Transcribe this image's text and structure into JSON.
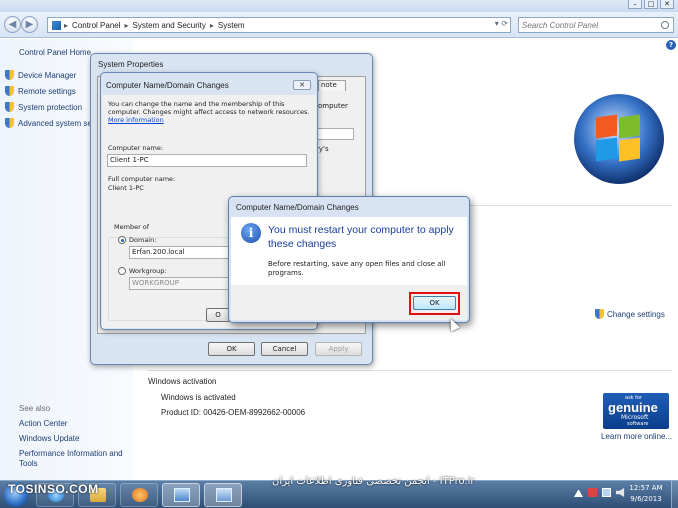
{
  "explorer": {
    "breadcrumbs": [
      "Control Panel",
      "System and Security",
      "System"
    ],
    "search_placeholder": "Search Control Panel"
  },
  "left_pane": {
    "home": "Control Panel Home",
    "links": [
      "Device Manager",
      "Remote settings",
      "System protection",
      "Advanced system se"
    ],
    "see_also_label": "See also",
    "see_also": [
      "Action Center",
      "Windows Update",
      "Performance Information and Tools"
    ]
  },
  "main": {
    "change_settings": "Change settings",
    "activation": {
      "title": "Windows activation",
      "status": "Windows is activated",
      "product_id": "Product ID: 00426-OEM-8992662-00006"
    },
    "genuine_badge": {
      "line1": "ask for",
      "line2": "genuine",
      "line3": "Microsoft",
      "line4": "software"
    },
    "learn_more": "Learn more online..."
  },
  "system_properties": {
    "title": "System Properties",
    "tab_fragment": "note",
    "text_fragments": [
      "omputer",
      "ry's"
    ],
    "buttons": {
      "ok": "OK",
      "cancel": "Cancel",
      "apply": "Apply"
    }
  },
  "name_domain_dialog": {
    "title": "Computer Name/Domain Changes",
    "close": "✕",
    "intro_line1": "You can change the name and the membership of this",
    "intro_line2": "computer. Changes might affect access to network resources.",
    "more_info": "More information",
    "computer_name_label": "Computer name:",
    "computer_name_value": "Client 1-PC",
    "full_name_label": "Full computer name:",
    "full_name_value": "Client 1-PC",
    "member_of_label": "Member of",
    "domain_label": "Domain:",
    "domain_value": "Erfan.200.local",
    "workgroup_label": "Workgroup:",
    "workgroup_value": "WORKGROUP",
    "ok_fragment": "O"
  },
  "restart_message": {
    "title": "Computer Name/Domain Changes",
    "main_line1": "You must restart your computer to apply",
    "main_line2": "these changes",
    "sub_line1": "Before restarting, save any open files and close all",
    "sub_line2": "programs.",
    "ok": "OK"
  },
  "taskbar": {
    "watermark_left": "TOSINSO.COM",
    "watermark_right": "ITPro.ir - انجمن تخصصی فناوری اطلاعات ایران",
    "time": "12:57 AM",
    "date": "9/6/2013"
  }
}
